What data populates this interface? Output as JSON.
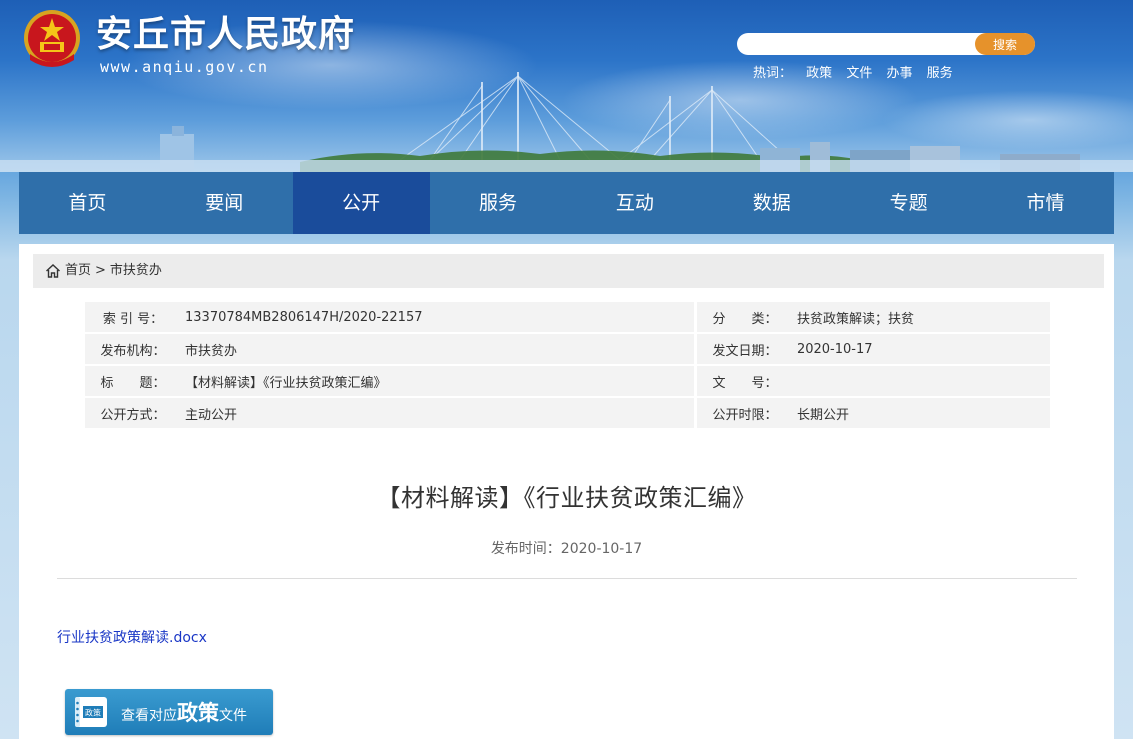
{
  "header": {
    "site_name": "安丘市人民政府",
    "site_url": "www.anqiu.gov.cn",
    "search": {
      "placeholder": "",
      "button_label": "搜索"
    },
    "hotwords": {
      "label": "热词：",
      "items": [
        "政策",
        "文件",
        "办事",
        "服务"
      ]
    }
  },
  "nav": {
    "items": [
      "首页",
      "要闻",
      "公开",
      "服务",
      "互动",
      "数据",
      "专题",
      "市情"
    ],
    "active": "公开"
  },
  "breadcrumb": {
    "home": "首页",
    "separator": ">",
    "current": "市扶贫办"
  },
  "meta": {
    "index_label": "索 引 号：",
    "index_value": "13370784MB2806147H/2020-22157",
    "category_label": "分　　类：",
    "category_value": "扶贫政策解读；扶贫",
    "publisher_label": "发布机构：",
    "publisher_value": "市扶贫办",
    "date_label": "发文日期：",
    "date_value": "2020-10-17",
    "title_label": "标　　题：",
    "title_value": "【材料解读】《行业扶贫政策汇编》",
    "doc_no_label": "文　　号：",
    "doc_no_value": "",
    "open_mode_label": "公开方式：",
    "open_mode_value": "主动公开",
    "open_period_label": "公开时限：",
    "open_period_value": "长期公开"
  },
  "article": {
    "title": "【材料解读】《行业扶贫政策汇编》",
    "pub_time": "发布时间：2020-10-17",
    "attachment": "行业扶贫政策解读.docx",
    "policy_button": {
      "prefix": "查看对应",
      "emphasis": "政策",
      "suffix": "文件",
      "badge": "政策"
    }
  },
  "colors": {
    "nav_bg": "#2f6faa",
    "nav_active": "#1a4c9b",
    "search_button": "#e6922b",
    "link": "#1a37c6"
  },
  "icons": [
    "national-emblem-icon",
    "home-icon",
    "policy-book-icon"
  ]
}
